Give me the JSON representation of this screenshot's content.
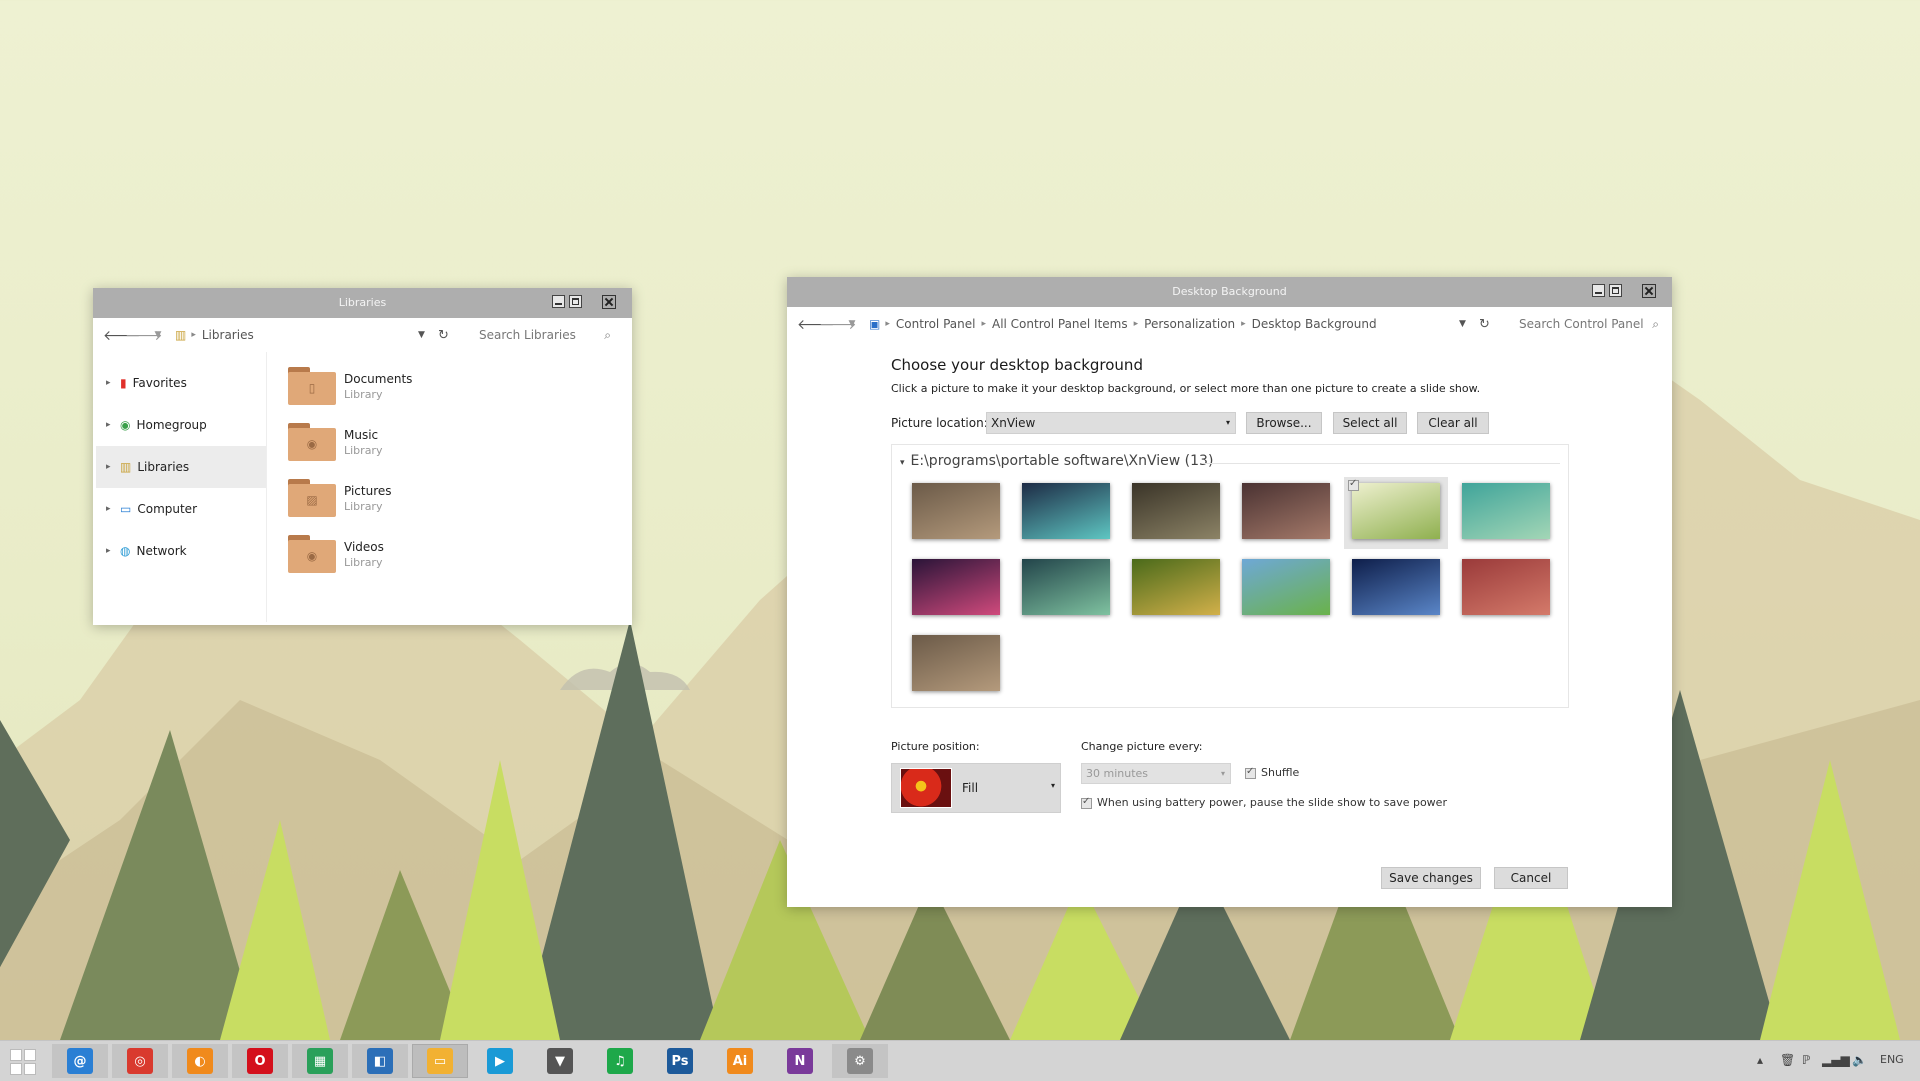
{
  "colors": {
    "titlebar": "#aeaeae",
    "folder": "#e0a878",
    "taskbar": "#d4d4d4"
  },
  "libraries_window": {
    "title": "Libraries",
    "breadcrumb": "Libraries",
    "search_placeholder": "Search Libraries",
    "sidebar": [
      {
        "label": "Favorites",
        "icon": "favorites-icon"
      },
      {
        "label": "Homegroup",
        "icon": "homegroup-icon"
      },
      {
        "label": "Libraries",
        "icon": "libraries-icon"
      },
      {
        "label": "Computer",
        "icon": "computer-icon"
      },
      {
        "label": "Network",
        "icon": "network-icon"
      }
    ],
    "selected_sidebar": "Libraries",
    "libraries": [
      {
        "name": "Documents",
        "type": "Library",
        "icon": "document-folder-icon"
      },
      {
        "name": "Music",
        "type": "Library",
        "icon": "music-folder-icon"
      },
      {
        "name": "Pictures",
        "type": "Library",
        "icon": "pictures-folder-icon"
      },
      {
        "name": "Videos",
        "type": "Library",
        "icon": "videos-folder-icon"
      }
    ]
  },
  "desktop_background_window": {
    "title": "Desktop Background",
    "breadcrumbs": [
      "Control Panel",
      "All Control Panel Items",
      "Personalization",
      "Desktop Background"
    ],
    "search_placeholder": "Search Control Panel",
    "heading": "Choose your desktop background",
    "instructions": "Click a picture to make it your desktop background, or select more than one picture to create a slide show.",
    "picture_location_label": "Picture location:",
    "picture_location_value": "XnView",
    "browse_label": "Browse...",
    "select_all_label": "Select all",
    "clear_all_label": "Clear all",
    "folder_group": "E:\\programs\\portable software\\XnView (13)",
    "thumbnails": [
      {
        "selected": false,
        "colors": [
          "#6b5a48",
          "#b49a7c"
        ]
      },
      {
        "selected": false,
        "colors": [
          "#1d2b45",
          "#5ec6c2"
        ]
      },
      {
        "selected": false,
        "colors": [
          "#3a3428",
          "#8c8366"
        ]
      },
      {
        "selected": false,
        "colors": [
          "#4a3232",
          "#a57a6a"
        ]
      },
      {
        "selected": true,
        "colors": [
          "#eef0cf",
          "#8fb04f"
        ]
      },
      {
        "selected": false,
        "colors": [
          "#3fa49a",
          "#a3d6b6"
        ]
      },
      {
        "selected": false,
        "colors": [
          "#2a1438",
          "#d04a7c"
        ]
      },
      {
        "selected": false,
        "colors": [
          "#22444a",
          "#7fc2a0"
        ]
      },
      {
        "selected": false,
        "colors": [
          "#4a6a1a",
          "#d2b04a"
        ]
      },
      {
        "selected": false,
        "colors": [
          "#6ea8d6",
          "#6ab24a"
        ]
      },
      {
        "selected": false,
        "colors": [
          "#0e1e4a",
          "#5a86c8"
        ]
      },
      {
        "selected": false,
        "colors": [
          "#9a3a3a",
          "#d47a6a"
        ]
      },
      {
        "selected": false,
        "colors": [
          "#6b5a48",
          "#b49a7c"
        ]
      }
    ],
    "picture_position_label": "Picture position:",
    "picture_position_value": "Fill",
    "change_picture_label": "Change picture every:",
    "change_picture_value": "30 minutes",
    "shuffle_label": "Shuffle",
    "battery_label": "When using battery power, pause the slide show to save power",
    "save_label": "Save changes",
    "cancel_label": "Cancel"
  },
  "taskbar": {
    "apps": [
      {
        "name": "mail-icon",
        "glyph": "@",
        "color": "#2a7fd4"
      },
      {
        "name": "chrome-icon",
        "glyph": "◎",
        "color": "#d93a2e"
      },
      {
        "name": "firefox-icon",
        "glyph": "◐",
        "color": "#f08a1c"
      },
      {
        "name": "opera-icon",
        "glyph": "O",
        "color": "#d4101c"
      },
      {
        "name": "spreadsheet-icon",
        "glyph": "▦",
        "color": "#2aa05a"
      },
      {
        "name": "finder-icon",
        "glyph": "◧",
        "color": "#2c6fb8"
      },
      {
        "name": "file-explorer-icon",
        "glyph": "▭",
        "color": "#f2b132"
      },
      {
        "name": "media-player-icon",
        "glyph": "▶",
        "color": "#1a9ad6"
      },
      {
        "name": "fox-icon",
        "glyph": "▼",
        "color": "#555555"
      },
      {
        "name": "music-icon",
        "glyph": "♫",
        "color": "#1ea84a"
      },
      {
        "name": "photoshop-icon",
        "glyph": "Ps",
        "color": "#1d5a9a"
      },
      {
        "name": "illustrator-icon",
        "glyph": "Ai",
        "color": "#f08a1c"
      },
      {
        "name": "onenote-icon",
        "glyph": "N",
        "color": "#7a3a9a"
      },
      {
        "name": "settings-icon",
        "glyph": "⚙",
        "color": "#8a8a8a"
      }
    ],
    "language": "ENG"
  }
}
